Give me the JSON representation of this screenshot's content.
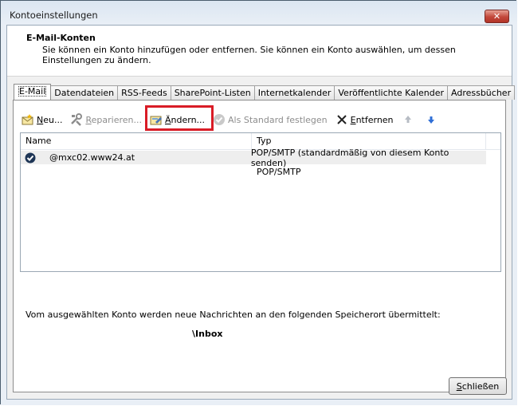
{
  "window": {
    "title": "Kontoeinstellungen",
    "close_glyph": "✕"
  },
  "header": {
    "title": "E-Mail-Konten",
    "description": "Sie können ein Konto hinzufügen oder entfernen. Sie können ein Konto auswählen, um dessen Einstellungen zu ändern."
  },
  "tabs": [
    {
      "label": "E-Mail",
      "active": true
    },
    {
      "label": "Datendateien"
    },
    {
      "label": "RSS-Feeds"
    },
    {
      "label": "SharePoint-Listen"
    },
    {
      "label": "Internetkalender"
    },
    {
      "label": "Veröffentlichte Kalender"
    },
    {
      "label": "Adressbücher"
    }
  ],
  "toolbar": {
    "new_u": "N",
    "new_rest": "eu...",
    "repair_u": "R",
    "repair_rest": "eparieren...",
    "change_u": "Ä",
    "change_rest": "ndern...",
    "default_label": "Als Standard festlegen",
    "remove_u": "E",
    "remove_rest": "ntfernen"
  },
  "list": {
    "col_name": "Name",
    "col_type": "Typ",
    "rows": [
      {
        "name": "@mxc02.www24.at",
        "type": "POP/SMTP (standardmäßig von diesem Konto senden)"
      },
      {
        "name": "",
        "type": "POP/SMTP"
      }
    ]
  },
  "footer": {
    "delivery_text": "Vom ausgewählten Konto werden neue Nachrichten an den folgenden Speicherort übermittelt:",
    "delivery_path": "\\Inbox"
  },
  "close_button": {
    "u": "S",
    "rest": "chließen"
  },
  "colors": {
    "highlight": "#d91c26",
    "titlebar": "#dbe6f2"
  }
}
